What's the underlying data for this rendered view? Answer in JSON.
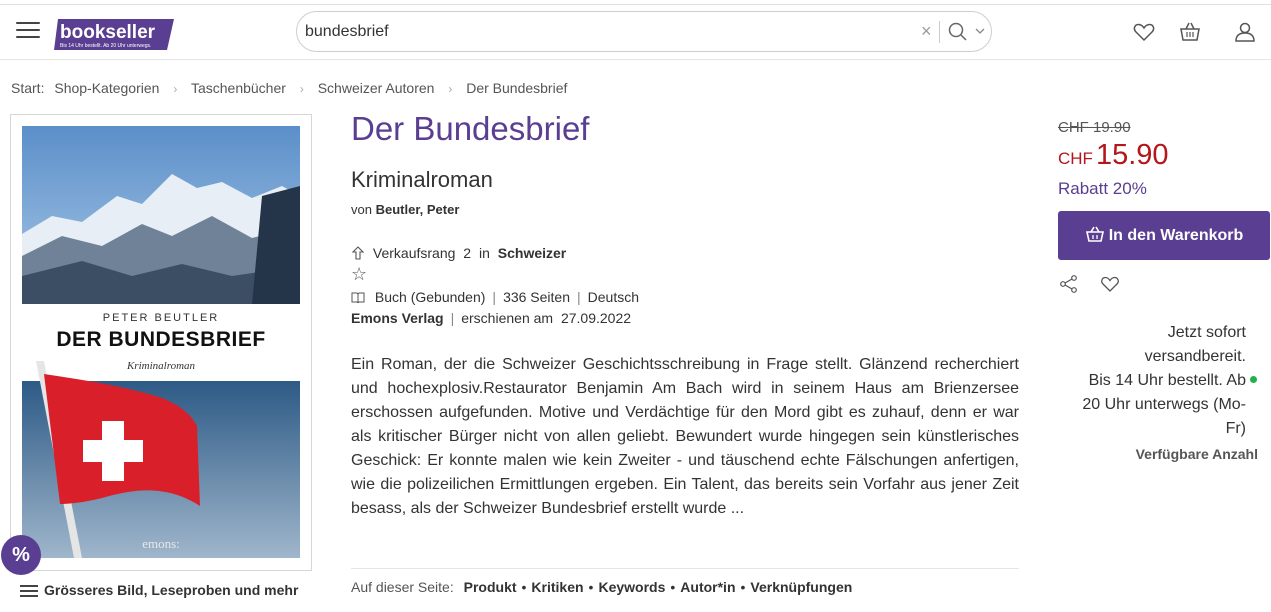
{
  "header": {
    "logo_text": "bookseller",
    "logo_tagline": "Bis 14 Uhr bestellt. Ab 20 Uhr unterwegs.",
    "search_value": "bundesbrief",
    "clear_symbol": "×",
    "icons": [
      "menu-icon",
      "clear-icon",
      "search-icon",
      "chevron-down-icon",
      "heart-icon",
      "basket-icon",
      "user-icon"
    ]
  },
  "breadcrumb": {
    "start": "Start:",
    "items": [
      "Shop-Kategorien",
      "Taschenbücher",
      "Schweizer Autoren",
      "Der Bundesbrief"
    ],
    "separator": "›"
  },
  "cover": {
    "author": "PETER BEUTLER",
    "title": "DER BUNDESBRIEF",
    "subtitle": "Kriminalroman",
    "publisher": "emons:"
  },
  "badge": "%",
  "more_link": "Grösseres Bild, Leseproben und mehr",
  "product": {
    "title": "Der Bundesbrief",
    "subtitle": "Kriminalroman",
    "by_prefix": "von",
    "author": "Beutler, Peter",
    "rank_label": "Verkaufsrang",
    "rank_value": "2",
    "rank_in": "in",
    "rank_category": "Schweizer",
    "star_symbol": "☆",
    "format": "Buch (Gebunden)",
    "pages": "336 Seiten",
    "language": "Deutsch",
    "publisher": "Emons Verlag",
    "published_label": "erschienen am",
    "published_date": "27.09.2022",
    "description": "Ein Roman, der die Schweizer Geschichtsschreibung in Frage stellt. Glänzend recherchiert und hochexplosiv.Restaurator Benjamin Am Bach wird in seinem Haus am Brienzersee erschossen aufgefunden. Motive und Verdächtige für den Mord gibt es zuhauf, denn er war als kritischer Bürger nicht von allen geliebt. Bewundert wurde hingegen sein künstlerisches Geschick: Er konnte malen wie kein Zweiter - und täuschend echte Fälschungen anfertigen, wie die polizeilichen Ermittlungen ergeben. Ein Talent, das bereits sein Vorfahr aus jener Zeit besass, als der Schweizer Bundesbrief erstellt wurde ..."
  },
  "on_page": {
    "label": "Auf dieser Seite:",
    "links": [
      "Produkt",
      "Kritiken",
      "Keywords",
      "Autor*in",
      "Verknüpfungen"
    ],
    "dot": "•"
  },
  "purchase": {
    "old_price": "CHF  19.90",
    "currency": "CHF",
    "price": "15.90",
    "discount": "Rabatt 20%",
    "cart_button": "In den Warenkorb",
    "availability_lines": [
      "Jetzt sofort",
      "versandbereit.",
      "Bis 14 Uhr bestellt. Ab",
      "20 Uhr unterwegs (Mo-",
      "Fr)"
    ],
    "quantity_label": "Verfügbare Anzahl"
  },
  "colors": {
    "brand_purple": "#5a3e91",
    "price_red": "#b3161b",
    "available_green": "#1db34a"
  }
}
